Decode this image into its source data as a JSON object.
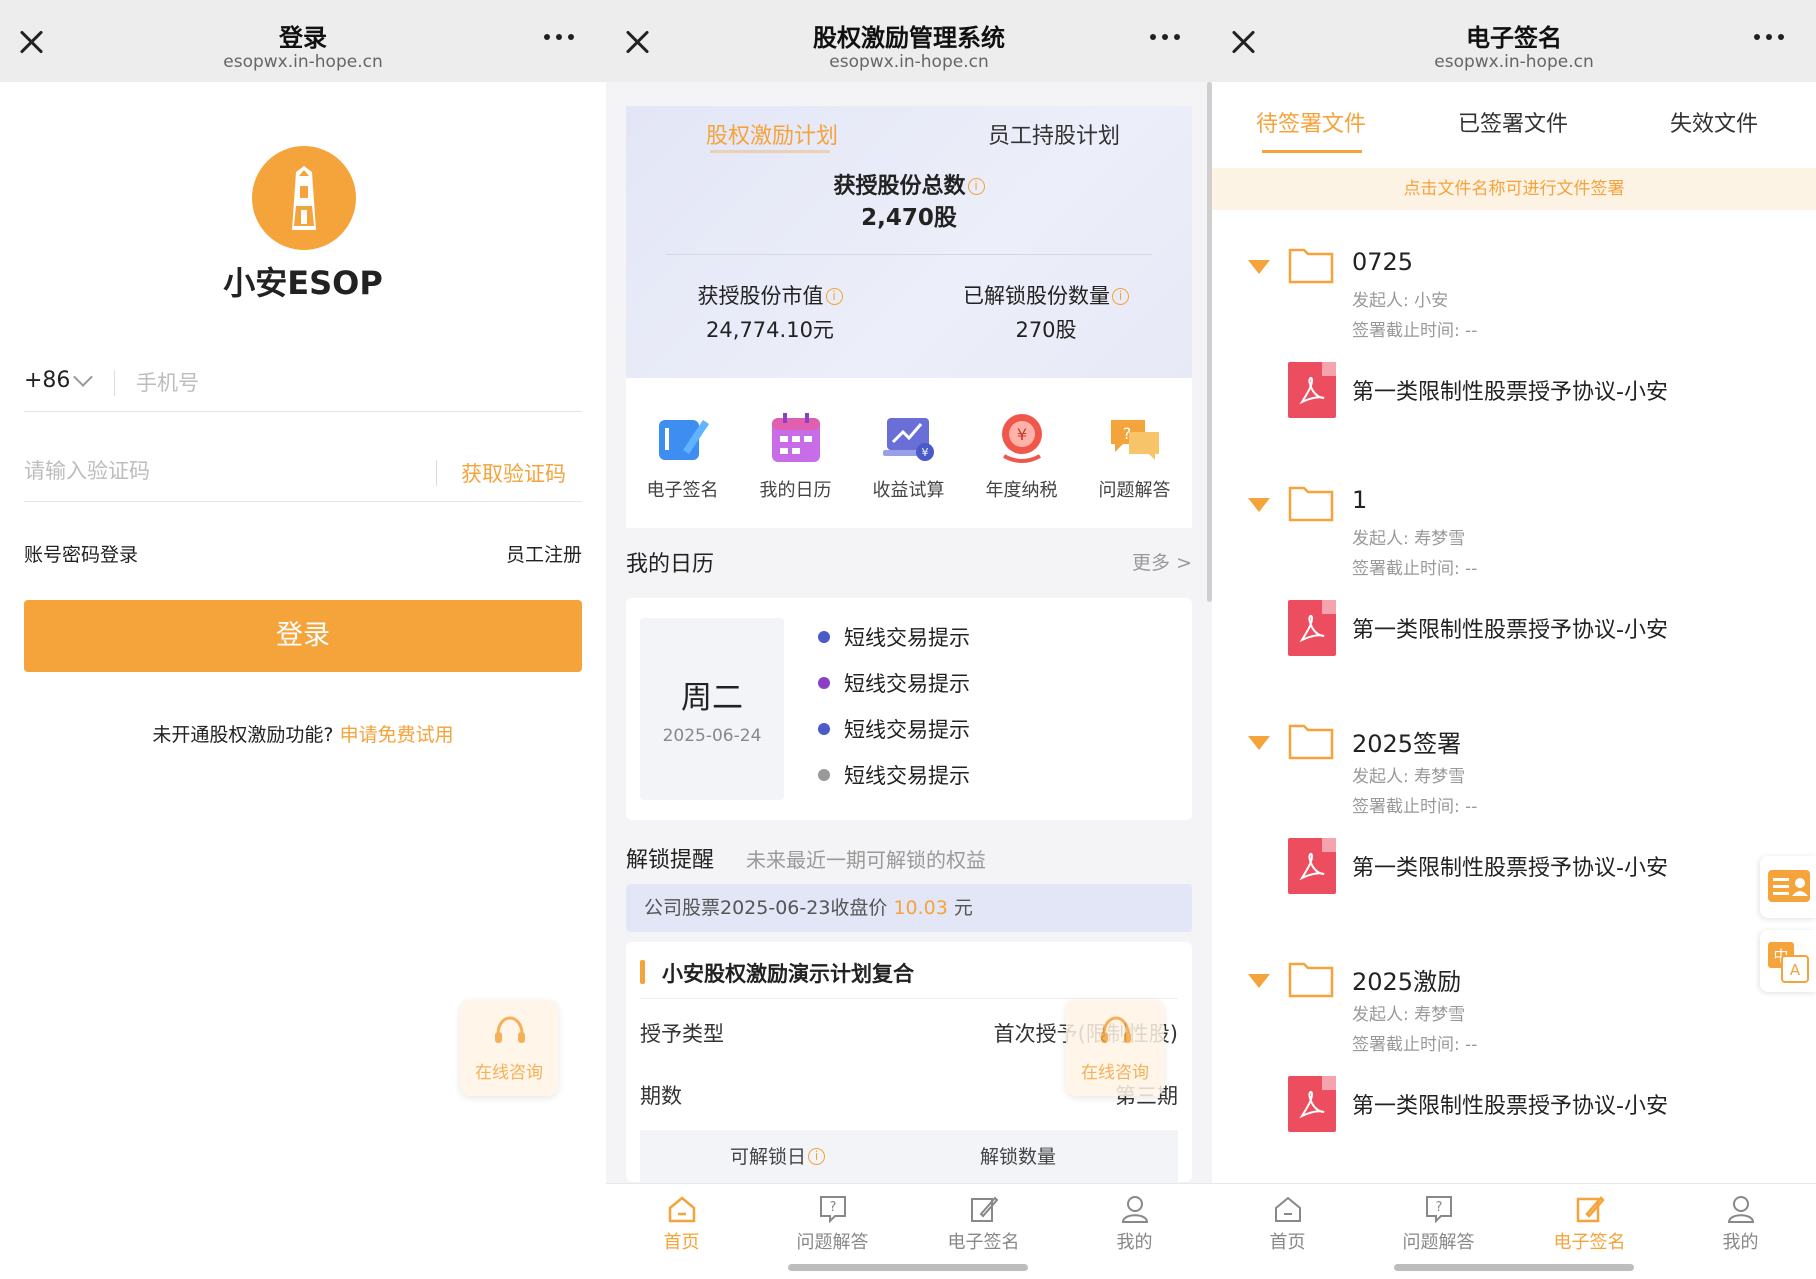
{
  "panels": [
    {
      "title": "登录",
      "url": "esopwx.in-hope.cn"
    },
    {
      "title": "股权激励管理系统",
      "url": "esopwx.in-hope.cn"
    },
    {
      "title": "电子签名",
      "url": "esopwx.in-hope.cn"
    }
  ],
  "login": {
    "brand": "小安ESOP",
    "country_code": "+86",
    "phone_placeholder": "手机号",
    "code_placeholder": "请输入验证码",
    "get_code": "获取验证码",
    "password_login": "账号密码登录",
    "register": "员工注册",
    "login_button": "登录",
    "trial_text": "未开通股权激励功能?",
    "trial_link": "申请免费试用",
    "consult": "在线咨询"
  },
  "dashboard": {
    "tabs": [
      "股权激励计划",
      "员工持股计划"
    ],
    "total_label": "获授股份总数",
    "total_value": "2,470股",
    "market_value_label": "获授股份市值",
    "market_value": "24,774.10元",
    "unlocked_label": "已解锁股份数量",
    "unlocked_value": "270股",
    "shortcuts": [
      "电子签名",
      "我的日历",
      "收益试算",
      "年度纳税",
      "问题解答"
    ],
    "calendar_title": "我的日历",
    "calendar_more": "更多 >",
    "weekday": "周二",
    "date": "2025-06-24",
    "events": [
      {
        "text": "短线交易提示",
        "color": "#4a5bc7"
      },
      {
        "text": "短线交易提示",
        "color": "#8a3fc4"
      },
      {
        "text": "短线交易提示",
        "color": "#4a5bc7"
      },
      {
        "text": "短线交易提示",
        "color": "#999999"
      }
    ],
    "unlock_title": "解锁提醒",
    "unlock_subtitle": "未来最近一期可解锁的权益",
    "price_prefix": "公司股票2025-06-23收盘价",
    "price_value": "10.03",
    "price_unit": "元",
    "plan_title": "小安股权激励演示计划复合",
    "grant_type_label": "授予类型",
    "grant_type_value": "首次授予(限制性股)",
    "period_label": "期数",
    "period_value": "第三期",
    "col_unlock_date": "可解锁日",
    "col_unlock_qty": "解锁数量",
    "consult": "在线咨询"
  },
  "tabbar": [
    "首页",
    "问题解答",
    "电子签名",
    "我的"
  ],
  "esign": {
    "tabs": [
      "待签署文件",
      "已签署文件",
      "失效文件"
    ],
    "hint": "点击文件名称可进行文件签署",
    "initiator_label": "发起人:",
    "deadline_label": "签署截止时间:",
    "folders": [
      {
        "name": "0725",
        "initiator": "小安",
        "deadline": "--",
        "doc": "第一类限制性股票授予协议-小安"
      },
      {
        "name": "1",
        "initiator": "寿梦雪",
        "deadline": "--",
        "doc": "第一类限制性股票授予协议-小安"
      },
      {
        "name": "2025签署",
        "initiator": "寿梦雪",
        "deadline": "--",
        "doc": "第一类限制性股票授予协议-小安"
      },
      {
        "name": "2025激励",
        "initiator": "寿梦雪",
        "deadline": "--",
        "doc": "第一类限制性股票授予协议-小安"
      }
    ]
  },
  "colors": {
    "accent": "#f5a33b",
    "pdf": "#ec4d5f",
    "hero_bg": "#e3e6f6"
  },
  "icons": [
    "close-icon",
    "more-icon",
    "headset-icon",
    "folder-icon",
    "pdf-icon",
    "home-icon",
    "question-icon",
    "sign-icon",
    "user-icon",
    "calendar-icon",
    "calculator-icon",
    "tax-icon",
    "chat-icon"
  ]
}
